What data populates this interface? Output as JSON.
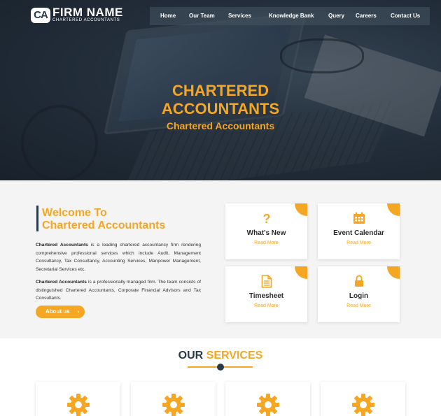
{
  "brand": {
    "badge": "CA",
    "name": "FIRM NAME",
    "tagline": "CHARTERED ACCOUNTANTS"
  },
  "nav": [
    "Home",
    "Our Team",
    "Services",
    "Knowledge Bank",
    "Query",
    "Careers",
    "Contact Us"
  ],
  "hero": {
    "title_line1": "CHARTERED",
    "title_line2": "ACCOUNTANTS",
    "subtitle": "Chartered Accountants"
  },
  "welcome": {
    "title_line1": "Welcome To",
    "title_line2": "Chartered Accountants",
    "p1_bold": "Chartered Accountants",
    "p1_text": " is a leading chartered accountancy firm rendering comprehensive professional services which include Audit, Management Consultancy, Tax Consultancy, Accounting Services, Manpower Management, Secretarial Services etc.",
    "p2_bold": "Chartered Accountants",
    "p2_text": " is a professionally managed firm. The team consists of distinguished Chartered Accountants, Corporate Financial Advisors and Tax Consultants.",
    "about_label": "About us",
    "about_chevron": "›"
  },
  "cards": [
    {
      "icon": "question-icon",
      "title": "What's New",
      "link": "Read More"
    },
    {
      "icon": "calendar-icon",
      "title": "Event Calendar",
      "link": "Read More"
    },
    {
      "icon": "document-icon",
      "title": "Timesheet",
      "link": "Read More"
    },
    {
      "icon": "lock-icon",
      "title": "Login",
      "link": "Read More"
    }
  ],
  "services": {
    "title_a": "OUR",
    "title_b": "SERVICES",
    "cards_icon": "gear-icon"
  },
  "colors": {
    "accent": "#f5a623",
    "dark": "#2b3a48"
  }
}
